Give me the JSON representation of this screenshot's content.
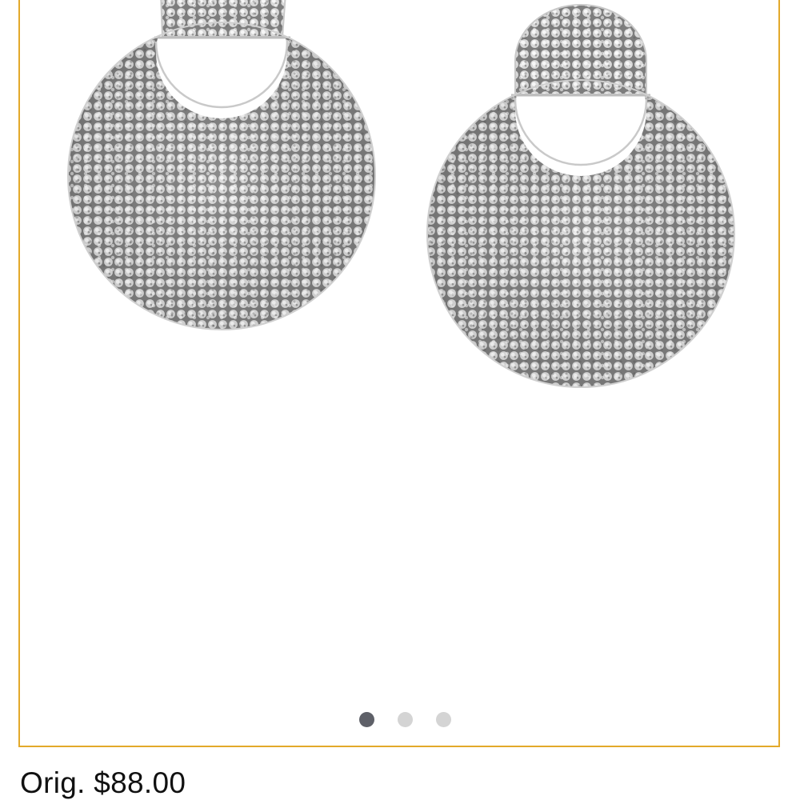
{
  "product": {
    "image_icon": "pave-disc-drop-earrings-icon",
    "carousel": {
      "slide_count": 3,
      "active_index": 0
    },
    "price": {
      "original_label": "Orig. $88.00"
    }
  },
  "colors": {
    "frame_border": "#e3a92a",
    "dot_active": "#5e6068",
    "dot_inactive": "#d4d4d4"
  }
}
